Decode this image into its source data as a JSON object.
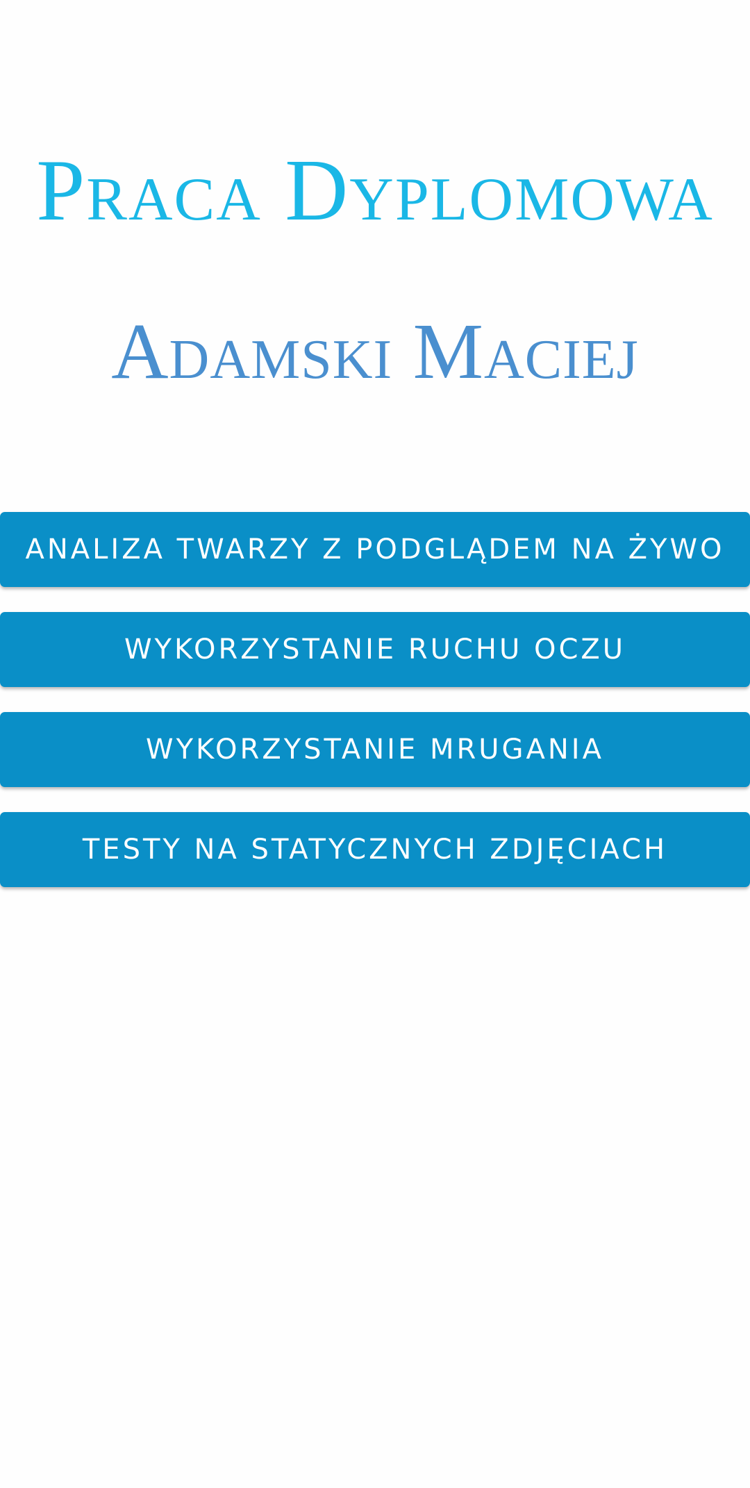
{
  "header": {
    "title": "Praca Dyplomowa",
    "author": "Adamski Maciej"
  },
  "menu": {
    "buttons": [
      {
        "label": "ANALIZA TWARZY Z PODGLĄDEM NA ŻYWO"
      },
      {
        "label": "WYKORZYSTANIE RUCHU OCZU"
      },
      {
        "label": "WYKORZYSTANIE MRUGANIA"
      },
      {
        "label": "TESTY NA STATYCZNYCH ZDJĘCIACH"
      }
    ]
  },
  "colors": {
    "background": "#fefefe",
    "title": "#1ab7e6",
    "author": "#4a8fcf",
    "button": "#0a8fc7",
    "button_text": "#ffffff"
  }
}
